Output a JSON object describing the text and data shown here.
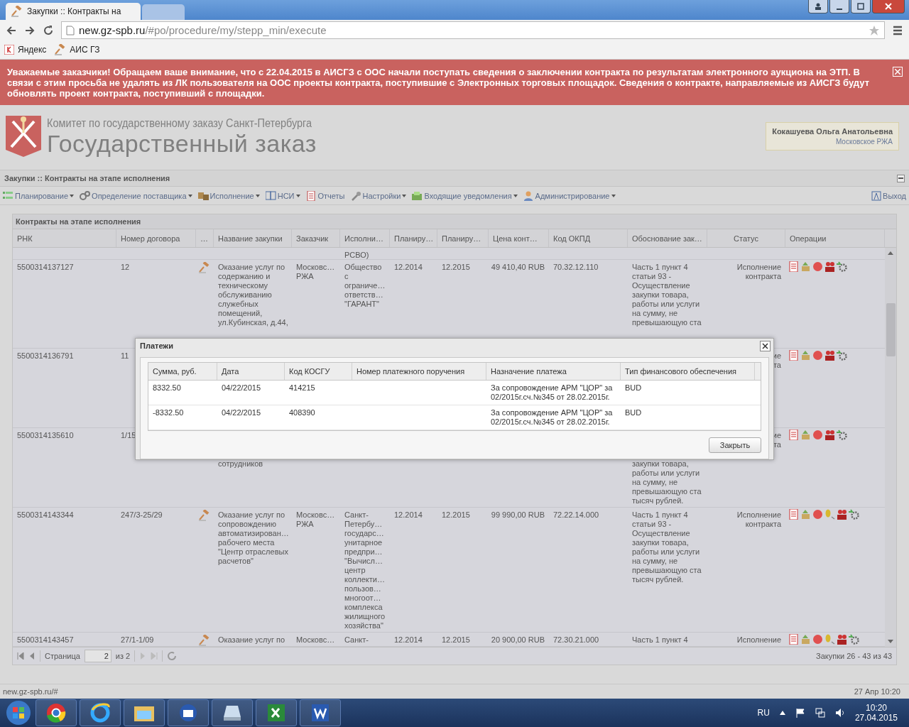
{
  "browser": {
    "tab_title": "Закупки :: Контракты на",
    "host": "new.gz-spb.ru",
    "path": "/#po/procedure/my/stepp_min/execute",
    "bookmarks": [
      {
        "label": "Яндекс",
        "kind": "yandex"
      },
      {
        "label": "АИС ГЗ",
        "kind": "gavel"
      }
    ]
  },
  "banner": {
    "text": "Уважаемые заказчики! Обращаем ваше внимание, что с 22.04.2015 в АИСГЗ с ООС начали поступать сведения о заключении контракта по результатам электронного аукциона на ЭТП. В связи с этим просьба не удалять из ЛК пользователя на ООС проекты контракта, поступившие с Электронных торговых площадок. Сведения о контракте, направляемые из АИСГЗ будут обновлять проект контракта, поступивший с площадки."
  },
  "header": {
    "org": "Комитет по государственному заказу Санкт-Петербурга",
    "title": "Государственный заказ",
    "user_name": "Кокашуева Ольга Анатольевна",
    "user_org": "Московское РЖА"
  },
  "page_title": "Закупки :: Контракты на этапе исполнения",
  "menu": [
    {
      "label": "Планирование",
      "kind": "plan",
      "dropdown": true
    },
    {
      "label": "Определение поставщика",
      "kind": "gears",
      "dropdown": true
    },
    {
      "label": "Исполнение",
      "kind": "boxes",
      "dropdown": true
    },
    {
      "label": "НСИ",
      "kind": "book",
      "dropdown": true
    },
    {
      "label": "Отчеты",
      "kind": "report",
      "dropdown": false
    },
    {
      "label": "Настройки",
      "kind": "wrench",
      "dropdown": true
    },
    {
      "label": "Входящие уведомления",
      "kind": "inbox",
      "dropdown": true
    },
    {
      "label": "Администрирование",
      "kind": "user",
      "dropdown": true
    }
  ],
  "exit": "Выход",
  "panel_title": "Контракты на этапе исполнения",
  "table": {
    "columns": [
      "РНК",
      "Номер договора",
      "…",
      "Название закупки",
      "Заказчик",
      "Исполни…",
      "Планиру…",
      "Планиру…",
      "Цена конт…",
      "Код ОКПД",
      "Обоснование зак…",
      "Статус",
      "Операции"
    ],
    "rows": [
      {
        "gavel": false,
        "cells": [
          null,
          null,
          null,
          null,
          null,
          "РСВО)",
          null,
          null,
          null,
          null,
          null,
          null
        ],
        "operations": []
      },
      {
        "gavel": true,
        "cells": [
          "5500314137127",
          "12",
          null,
          "Оказание услуг по\nсодержанию и\nтехническому\nобслуживанию\nслужебных\nпомещений,\nул.Кубинская, д.44,",
          "Московс…\nРЖА",
          "Общество\nс\nограниче…\nответств…\n\"ГАРАНТ\"",
          "12.2014",
          "12.2015",
          "49 410,40 RUB",
          "70.32.12.110",
          "Часть 1 пункт 4\nстатьи 93 -\nОсуществление\nзакупки товара,\nработы или услуги\nна сумму, не\nпревышающую ста",
          "Исполнение\nконтракта"
        ],
        "operations": [
          {
            "kind": "document"
          },
          {
            "kind": "tray"
          },
          {
            "kind": "stop"
          },
          {
            "kind": "users"
          },
          {
            "kind": "gear"
          }
        ]
      },
      {
        "gavel": false,
        "cells": [
          "5500314136791",
          "11",
          null,
          null,
          null,
          null,
          null,
          null,
          null,
          null,
          null,
          "ие\nта"
        ],
        "operations": [
          {
            "kind": "document"
          },
          {
            "kind": "tray"
          },
          {
            "kind": "stop"
          },
          {
            "kind": "users"
          },
          {
            "kind": "gear"
          }
        ]
      },
      {
        "gavel": false,
        "cells": [
          "5500314135610",
          "1/15",
          null,
          {
            "text": "сотрудников",
            "below_dialog": true
          },
          null,
          null,
          null,
          null,
          null,
          null,
          {
            "text": "закупки товара,\nработы или услуги\nна сумму, не\nпревышающую ста\nтысяч рублей.",
            "below_dialog": true
          },
          "ие\nта"
        ],
        "operations": [
          {
            "kind": "document"
          },
          {
            "kind": "tray"
          },
          {
            "kind": "stop"
          },
          {
            "kind": "users"
          },
          {
            "kind": "gear"
          }
        ]
      },
      {
        "gavel": true,
        "cells": [
          "5500314143344",
          "247/3-25/29",
          null,
          "Оказание услуг по\nсопровождению\nавтоматизирован…\nрабочего места\n\"Центр отраслевых\nрасчетов\"",
          "Московс…\nРЖА",
          "Санкт-\nПетербу…\nгосударс…\nунитарное\nпредпри…\n\"Вычисл…\nцентр\nколлекти…\nпользов…\nмногоот…\nкомплекса\nжилищного\nхозяйства\"",
          "12.2014",
          "12.2015",
          "99 990,00 RUB",
          "72.22.14.000",
          "Часть 1 пункт 4\nстатьи 93 -\nОсуществление\nзакупки товара,\nработы или услуги\nна сумму, не\nпревышающую ста\nтысяч рублей.",
          "Исполнение\nконтракта"
        ],
        "operations": [
          {
            "kind": "document"
          },
          {
            "kind": "tray"
          },
          {
            "kind": "stop"
          },
          {
            "kind": "coin"
          },
          {
            "kind": "users"
          },
          {
            "kind": "gear"
          }
        ]
      },
      {
        "gavel": true,
        "cells": [
          "5500314143457",
          "27/1-1/09",
          null,
          "Оказание услуг по",
          "Московс…",
          "Санкт-",
          "12.2014",
          "12.2015",
          "20 900,00 RUB",
          "72.30.21.000",
          "Часть 1 пункт 4",
          "Исполнение"
        ],
        "operations": [
          {
            "kind": "document"
          },
          {
            "kind": "tray"
          },
          {
            "kind": "stop"
          },
          {
            "kind": "coin"
          },
          {
            "kind": "users"
          },
          {
            "kind": "gear"
          }
        ]
      }
    ]
  },
  "pager": {
    "page_label": "Страница",
    "page": "2",
    "of": "из 2",
    "summary": "Закупки 26 - 43 из 43"
  },
  "dialog": {
    "title": "Платежи",
    "columns": [
      "Сумма, руб.",
      "Дата",
      "Код КОСГУ",
      "Номер платежного поручения",
      "Назначение платежа",
      "Тип финансового обеспечения"
    ],
    "rows": [
      [
        "8332.50",
        "04/22/2015",
        "414215",
        null,
        "За сопровождение АРМ \"ЦОР\" за\n02/2015г.сч.№345 от 28.02.2015г.",
        "BUD"
      ],
      [
        "-8332.50",
        "04/22/2015",
        "408390",
        null,
        "За сопровождение АРМ \"ЦОР\" за\n02/2015г.сч.№345 от 28.02.2015г.",
        "BUD"
      ]
    ],
    "close_button": "Закрыть"
  },
  "status_bar": {
    "url": "new.gz-spb.ru/#",
    "time": "27 Апр 10:20"
  },
  "taskbar": {
    "language": "RU",
    "time": "10:20",
    "date": "27.04.2015"
  }
}
